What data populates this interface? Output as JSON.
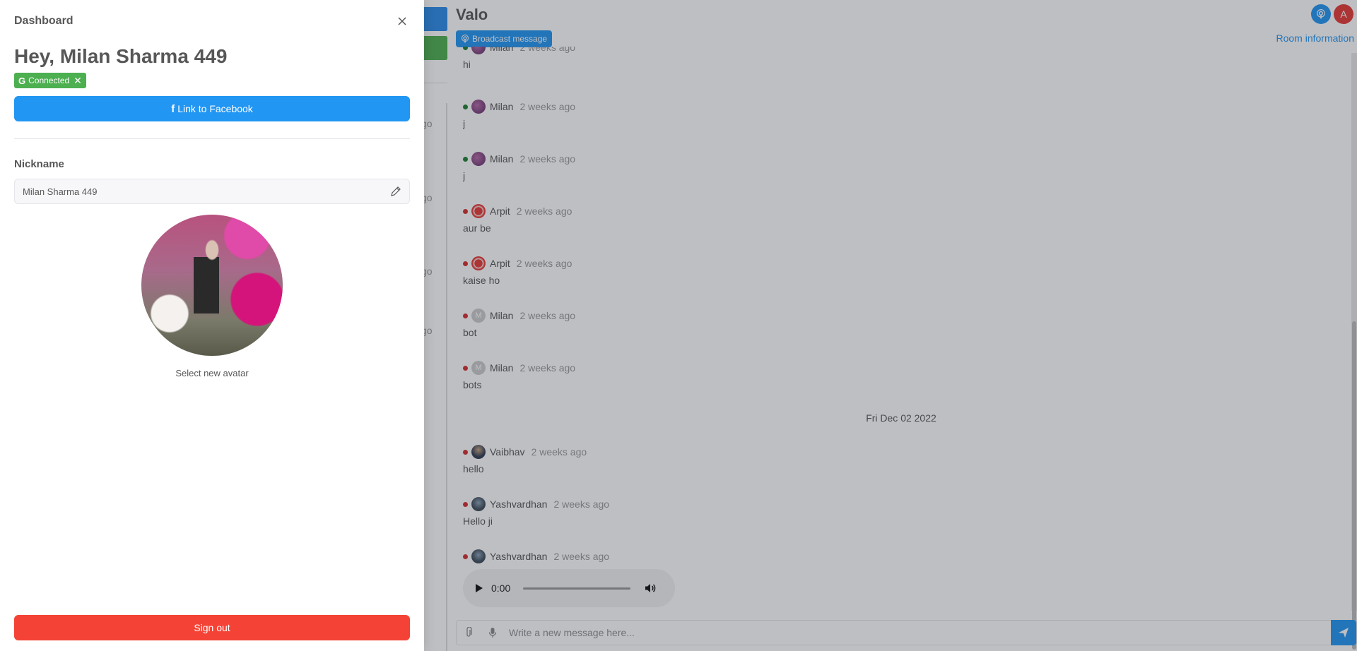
{
  "drawer": {
    "title": "Dashboard",
    "greeting": "Hey, Milan Sharma 449",
    "connected_badge": "Connected",
    "facebook_button": "Link to Facebook",
    "nickname_label": "Nickname",
    "nickname_value": "Milan Sharma 449",
    "select_avatar": "Select new avatar",
    "sign_out": "Sign out"
  },
  "background_sidebar": {
    "partial_times": [
      "go",
      "go",
      "go",
      "go"
    ]
  },
  "room": {
    "title": "Valo",
    "broadcast_button": "Broadcast message",
    "room_info": "Room information",
    "user_avatar_initial": "A"
  },
  "messages": [
    {
      "author": "Milan",
      "status": "green",
      "avatar": "image",
      "time": "2 weeks ago",
      "text": "hi"
    },
    {
      "author": "Milan",
      "status": "green",
      "avatar": "image",
      "time": "2 weeks ago",
      "text": "j"
    },
    {
      "author": "Milan",
      "status": "green",
      "avatar": "image",
      "time": "2 weeks ago",
      "text": "j"
    },
    {
      "author": "Arpit",
      "status": "red",
      "avatar": "image",
      "time": "2 weeks ago",
      "text": "aur be"
    },
    {
      "author": "Arpit",
      "status": "red",
      "avatar": "image",
      "time": "2 weeks ago",
      "text": "kaise ho"
    },
    {
      "author": "Milan",
      "status": "red",
      "avatar": "M",
      "time": "2 weeks ago",
      "text": "bot"
    },
    {
      "author": "Milan",
      "status": "red",
      "avatar": "M",
      "time": "2 weeks ago",
      "text": "bots"
    }
  ],
  "date_separator": "Fri Dec 02 2022",
  "messages_after": [
    {
      "author": "Vaibhav",
      "status": "red",
      "avatar": "image",
      "time": "2 weeks ago",
      "text": "hello"
    },
    {
      "author": "Yashvardhan",
      "status": "red",
      "avatar": "image",
      "time": "2 weeks ago",
      "text": "Hello ji"
    },
    {
      "author": "Yashvardhan",
      "status": "red",
      "avatar": "image",
      "time": "2 weeks ago",
      "text": ""
    }
  ],
  "audio": {
    "time": "0:00"
  },
  "composer": {
    "placeholder": "Write a new message here..."
  },
  "colors": {
    "primary": "#2196f3",
    "success": "#4caf50",
    "danger": "#f44336"
  }
}
